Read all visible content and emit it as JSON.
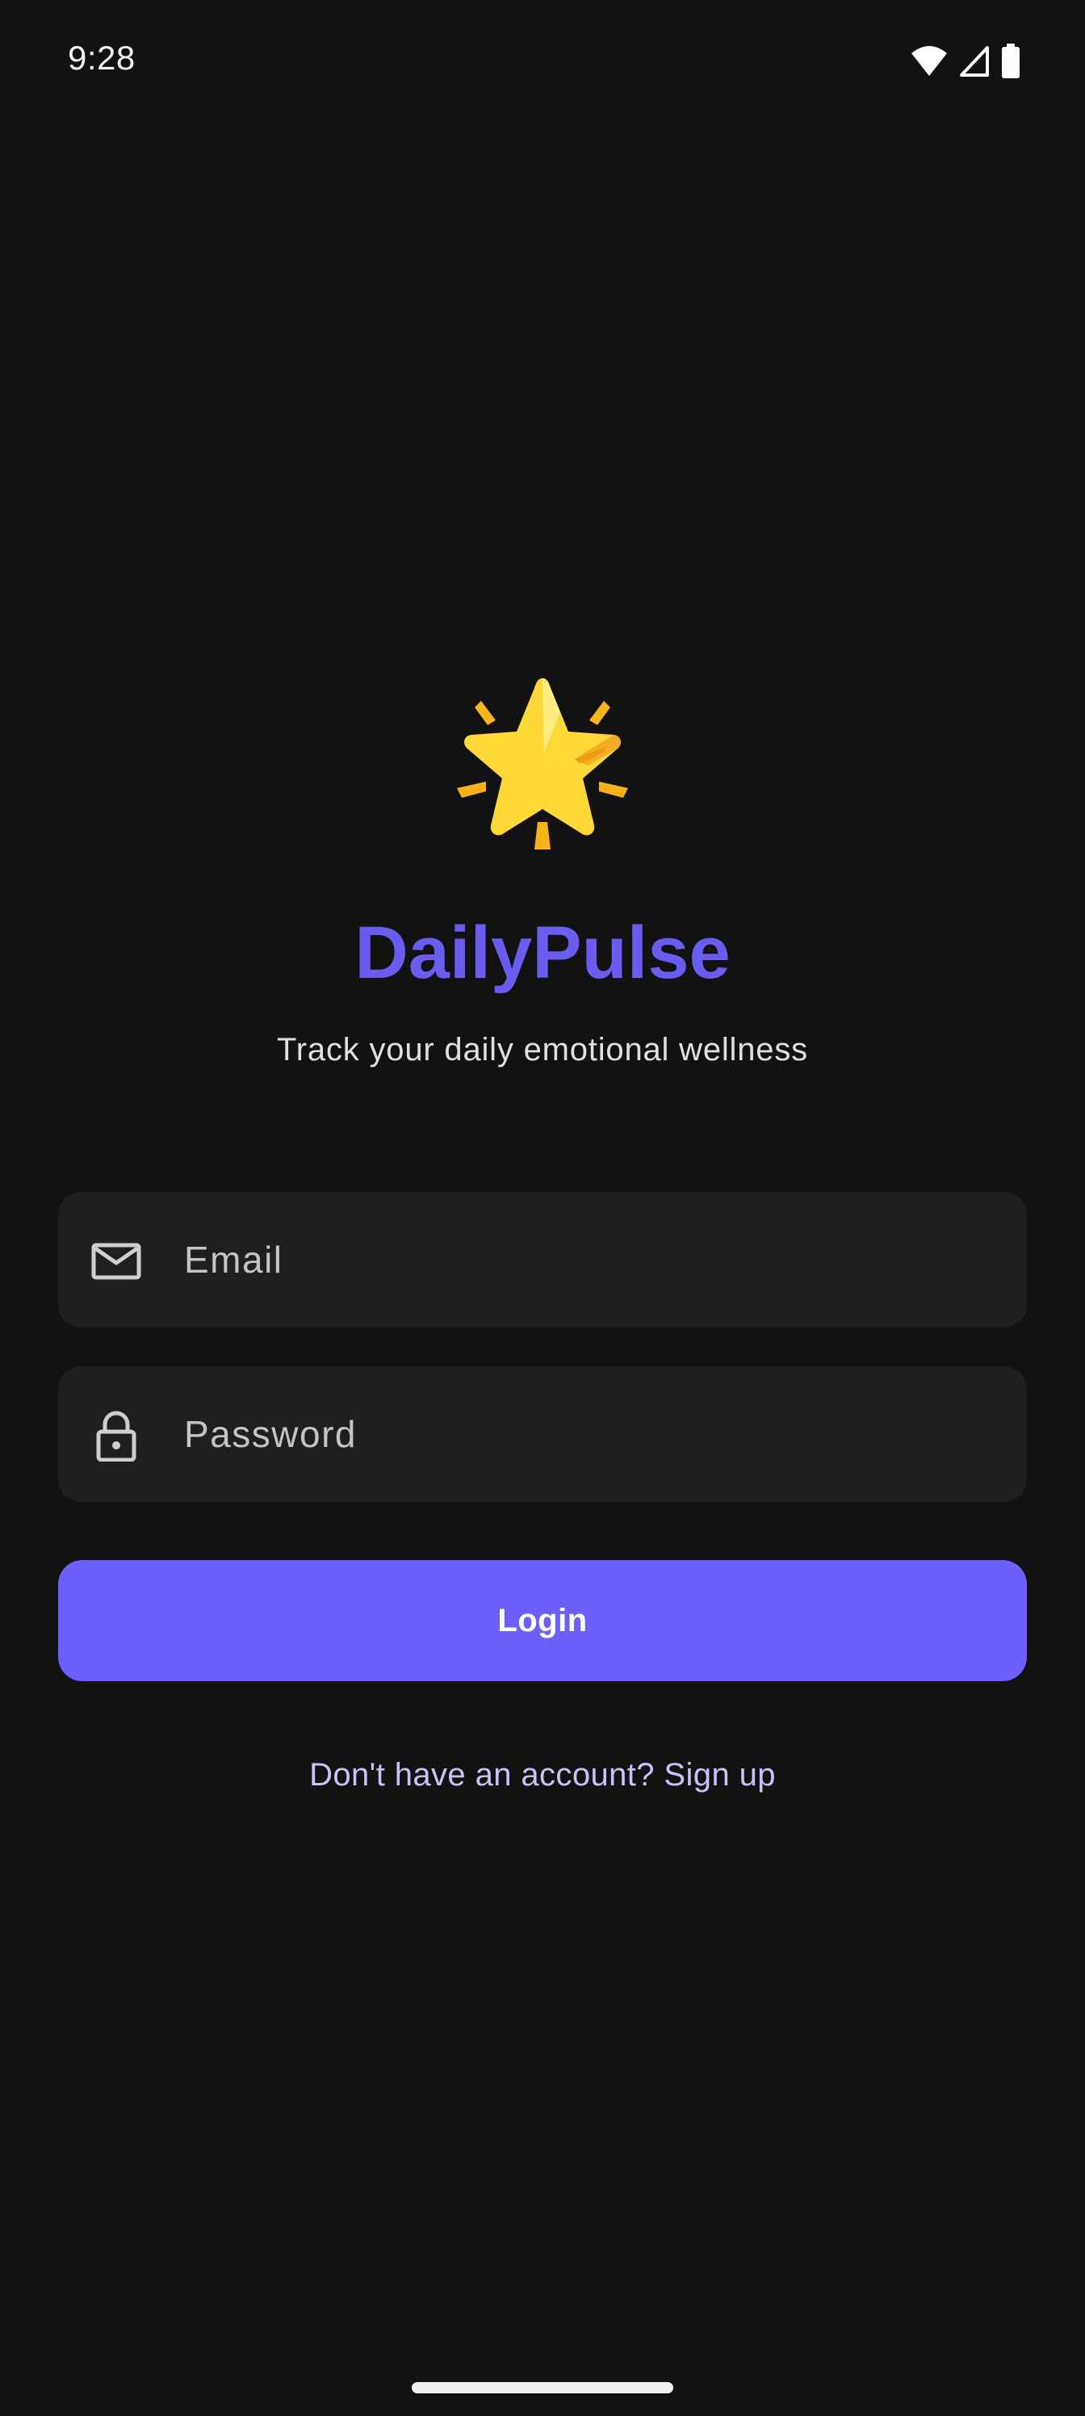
{
  "status_bar": {
    "time": "9:28",
    "icons": [
      "wifi-icon",
      "cell-signal-icon",
      "battery-icon"
    ]
  },
  "logo": {
    "icon": "glowing-star-icon"
  },
  "app": {
    "title": "DailyPulse",
    "subtitle": "Track your daily emotional wellness"
  },
  "form": {
    "email": {
      "icon": "mail-icon",
      "placeholder": "Email",
      "value": ""
    },
    "password": {
      "icon": "lock-icon",
      "placeholder": "Password",
      "value": ""
    },
    "login_label": "Login",
    "signup_text": "Don't have an account? Sign up"
  },
  "colors": {
    "background": "#121212",
    "accent": "#6c5ffc",
    "title": "#6b5cf0",
    "field_background": "#1f1f1f",
    "link": "#c9c2f7"
  }
}
